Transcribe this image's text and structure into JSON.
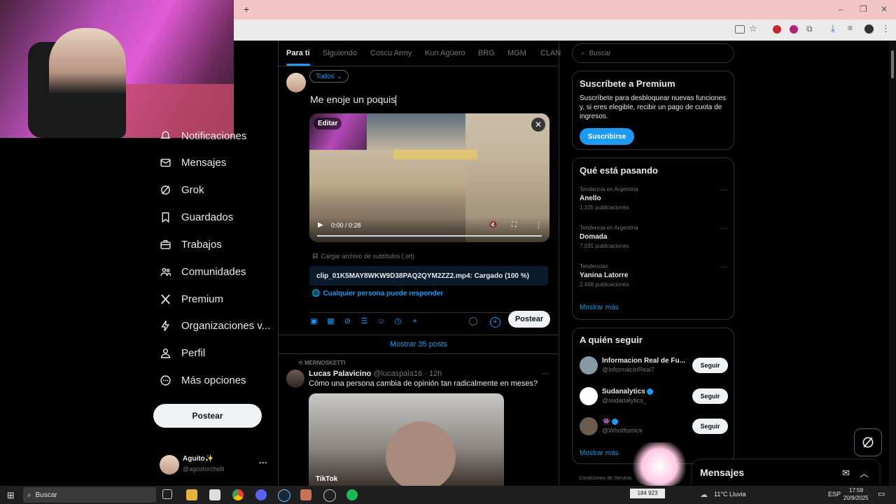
{
  "browser": {
    "new_tab": "+",
    "window_controls": [
      "–",
      "❐",
      "✕"
    ]
  },
  "sidebar": {
    "items": [
      {
        "label": "Notificaciones",
        "icon": "bell-icon"
      },
      {
        "label": "Mensajes",
        "icon": "envelope-icon"
      },
      {
        "label": "Grok",
        "icon": "grok-icon"
      },
      {
        "label": "Guardados",
        "icon": "bookmark-icon"
      },
      {
        "label": "Trabajos",
        "icon": "briefcase-icon"
      },
      {
        "label": "Comunidades",
        "icon": "people-icon"
      },
      {
        "label": "Premium",
        "icon": "x-logo-icon"
      },
      {
        "label": "Organizaciones v...",
        "icon": "lightning-icon"
      },
      {
        "label": "Perfil",
        "icon": "person-icon"
      },
      {
        "label": "Más opciones",
        "icon": "more-circle-icon"
      }
    ],
    "post_button": "Postear",
    "profile": {
      "name": "Aguito✨",
      "handle": "@agostorchelli",
      "more": "···"
    }
  },
  "main": {
    "tabs": [
      "Para ti",
      "Siguiendo",
      "Coscu Army",
      "Kun Agüero",
      "BRG",
      "MGM",
      "CLAN"
    ],
    "compose": {
      "audience": "Todos",
      "text": "Me enoje un poquis",
      "edit_label": "Editar",
      "video_time": "0:00 / 0:28",
      "subtitle_link": "Cargar archivo de subtítulos (.srt)",
      "upload_status": "clip_01K5MAY8WKW9D38PAQ2QYM2ZZ2.mp4: Cargado (100 %)",
      "reply_setting": "Cualquier persona puede responder",
      "post_button": "Postear"
    },
    "show_posts": "Mostrar 35 posts",
    "tweet": {
      "retweeted_by": "MERNOSKETTI",
      "name": "Lucas Palavicino",
      "handle": "@lucaspala16",
      "time": "· 12h",
      "text": "Cómo una persona cambia de opinión tan radicalmente en meses?",
      "more": "···",
      "watermark": "TikTok"
    }
  },
  "right": {
    "search_placeholder": "Buscar",
    "premium": {
      "title": "Suscríbete a Premium",
      "text": "Suscríbete para desbloquear nuevas funciones y, si eres elegible, recibir un pago de cuota de ingresos.",
      "button": "Suscribirse"
    },
    "trends": {
      "title": "Qué está pasando",
      "items": [
        {
          "context": "Tendencia en Argentina",
          "name": "Anello",
          "count": "1.105 publicaciones"
        },
        {
          "context": "Tendencia en Argentina",
          "name": "Domada",
          "count": "7.031 publicaciones"
        },
        {
          "context": "Tendencias",
          "name": "Yanina Latorre",
          "count": "2.468 publicaciones"
        }
      ],
      "show_more": "Mostrar más"
    },
    "follow": {
      "title": "A quién seguir",
      "items": [
        {
          "name": "Informacion Real de Fu...",
          "handle": "@InformacInReal7",
          "button": "Seguir"
        },
        {
          "name": "Sudanalytics",
          "handle": "@sudanalytics_",
          "button": "Seguir"
        },
        {
          "name": "👾",
          "handle": "@Whotfismick",
          "button": "Seguir"
        }
      ],
      "show_more": "Mostrar más"
    },
    "footer": "Condiciones de Servicio"
  },
  "messages_dock": {
    "title": "Mensajes"
  },
  "taskbar": {
    "search": "Buscar",
    "counter": "184 923",
    "weather": "11°C Lluvia",
    "lang": "ESP",
    "time": "17:59",
    "date": "20/9/2025"
  },
  "colors": {
    "accent": "#1d9bf0",
    "background": "#000000",
    "text": "#e7e9ea",
    "muted": "#71767b"
  }
}
